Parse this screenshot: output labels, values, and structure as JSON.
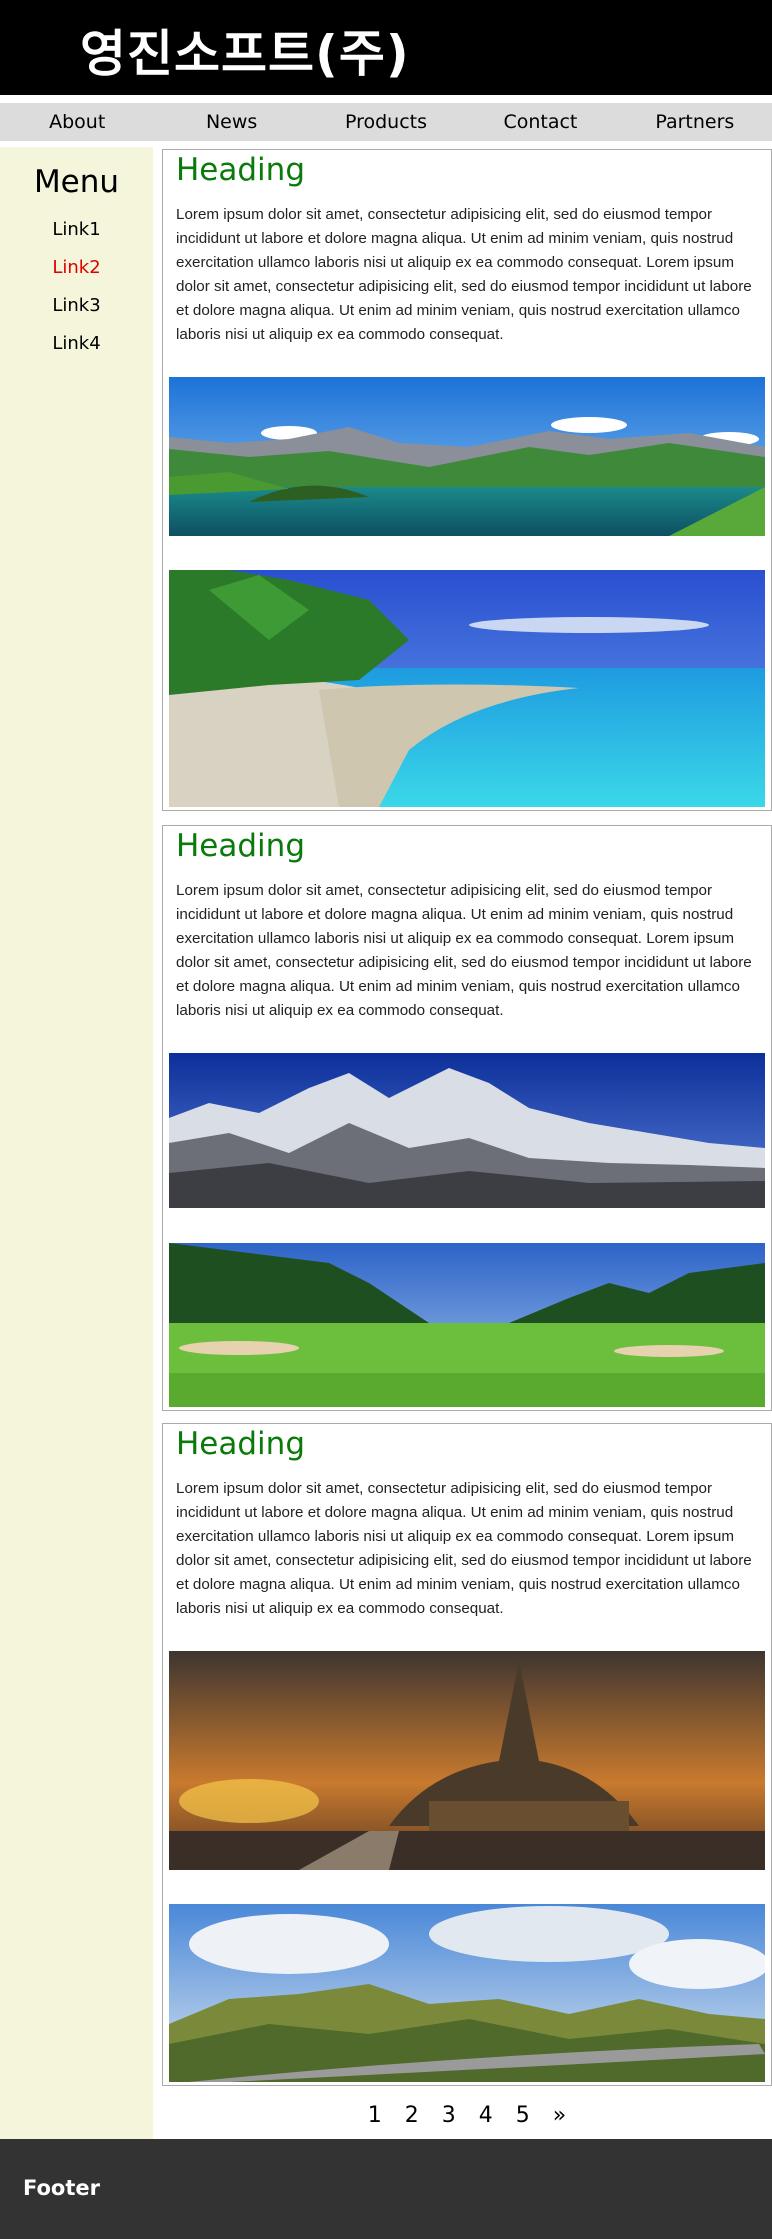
{
  "header": {
    "title": "영진소프트(주)"
  },
  "nav": {
    "items": [
      "About",
      "News",
      "Products",
      "Contact",
      "Partners"
    ]
  },
  "sidebar": {
    "title": "Menu",
    "links": [
      "Link1",
      "Link2",
      "Link3",
      "Link4"
    ],
    "active_link": "Link2",
    "active_color": "#e00000"
  },
  "articles": [
    {
      "heading": "Heading",
      "body": "Lorem ipsum dolor sit amet, consectetur adipisicing elit, sed do eiusmod tempor incididunt ut labore et dolore magna aliqua. Ut enim ad minim veniam, quis nostrud exercitation ullamco laboris nisi ut aliquip ex ea commodo consequat. Lorem ipsum dolor sit amet, consectetur adipisicing elit, sed do eiusmod tempor incididunt ut labore et dolore magna aliqua. Ut enim ad minim veniam, quis nostrud exercitation ullamco laboris nisi ut aliquip ex ea commodo consequat.",
      "images": [
        "mountain-lake-image",
        "tropical-beach-image"
      ]
    },
    {
      "heading": "Heading",
      "body": "Lorem ipsum dolor sit amet, consectetur adipisicing elit, sed do eiusmod tempor incididunt ut labore et dolore magna aliqua. Ut enim ad minim veniam, quis nostrud exercitation ullamco laboris nisi ut aliquip ex ea commodo consequat. Lorem ipsum dolor sit amet, consectetur adipisicing elit, sed do eiusmod tempor incididunt ut labore et dolore magna aliqua. Ut enim ad minim veniam, quis nostrud exercitation ullamco laboris nisi ut aliquip ex ea commodo consequat.",
      "images": [
        "snowy-mountains-image",
        "golf-course-image"
      ]
    },
    {
      "heading": "Heading",
      "body": "Lorem ipsum dolor sit amet, consectetur adipisicing elit, sed do eiusmod tempor incididunt ut labore et dolore magna aliqua. Ut enim ad minim veniam, quis nostrud exercitation ullamco laboris nisi ut aliquip ex ea commodo consequat. Lorem ipsum dolor sit amet, consectetur adipisicing elit, sed do eiusmod tempor incididunt ut labore et dolore magna aliqua. Ut enim ad minim veniam, quis nostrud exercitation ullamco laboris nisi ut aliquip ex ea commodo consequat.",
      "images": [
        "castle-sunset-image",
        "valley-road-image"
      ]
    }
  ],
  "pagination": {
    "pages": [
      "1",
      "2",
      "3",
      "4",
      "5"
    ],
    "next": "»"
  },
  "footer": {
    "text": "Footer"
  },
  "colors": {
    "heading": "#0a7a0a",
    "sidebar_bg": "#f5f5dc",
    "header_bg": "#000000",
    "footer_bg": "#333333"
  }
}
